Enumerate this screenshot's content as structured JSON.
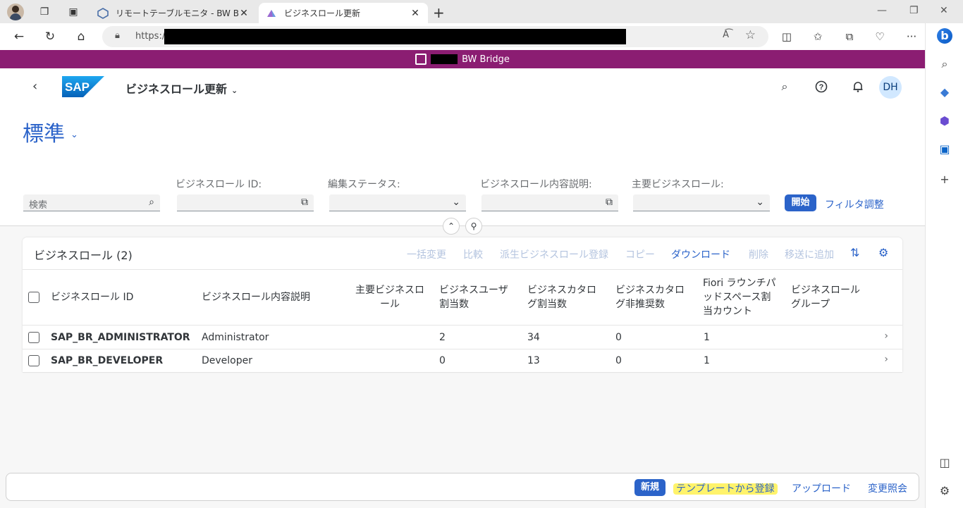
{
  "browser": {
    "tabs": [
      {
        "title": "リモートテーブルモニタ - BW Bridge (S"
      },
      {
        "title": "ビジネスロール更新"
      }
    ],
    "url_scheme": "https://"
  },
  "systembar": {
    "title": "BW Bridge"
  },
  "shell": {
    "app_title": "ビジネスロール更新",
    "avatar_initials": "DH"
  },
  "header": {
    "variant": "標準",
    "filters": {
      "search_placeholder": "検索",
      "role_id_label": "ビジネスロール ID:",
      "edit_status_label": "編集ステータス:",
      "description_label": "ビジネスロール内容説明:",
      "main_role_label": "主要ビジネスロール:"
    },
    "go_button": "開始",
    "adapt_filters": "フィルタ調整"
  },
  "table": {
    "title": "ビジネスロール (2)",
    "actions": {
      "mass_change": "一括変更",
      "compare": "比較",
      "derive": "派生ビジネスロール登録",
      "copy": "コピー",
      "download": "ダウンロード",
      "delete": "削除",
      "add_transport": "移送に追加"
    },
    "columns": {
      "role_id": "ビジネスロール ID",
      "description": "ビジネスロール内容説明",
      "main_role": [
        "主要ビジネスロ",
        "ール"
      ],
      "user_count": [
        "ビジネスユーザ",
        "割当数"
      ],
      "catalog_count": [
        "ビジネスカタロ",
        "グ割当数"
      ],
      "deprecated_count": [
        "ビジネスカタロ",
        "グ非推奨数"
      ],
      "fiori_count": [
        "Fiori ラウンチパ",
        "ッドスペース割",
        "当カウント"
      ],
      "group": [
        "ビジネスロール",
        "グループ"
      ]
    },
    "rows": [
      {
        "id": "SAP_BR_ADMINISTRATOR",
        "description": "Administrator",
        "users": "2",
        "catalogs": "34",
        "deprecated": "0",
        "fiori": "1"
      },
      {
        "id": "SAP_BR_DEVELOPER",
        "description": "Developer",
        "users": "0",
        "catalogs": "13",
        "deprecated": "0",
        "fiori": "1"
      }
    ]
  },
  "footer": {
    "new": "新規",
    "from_template": "テンプレートから登録",
    "upload": "アップロード",
    "change_log": "変更照会"
  },
  "colors": {
    "systembar": "#8b1d72",
    "accent": "#2b63c9",
    "highlight": "#fff36b"
  }
}
